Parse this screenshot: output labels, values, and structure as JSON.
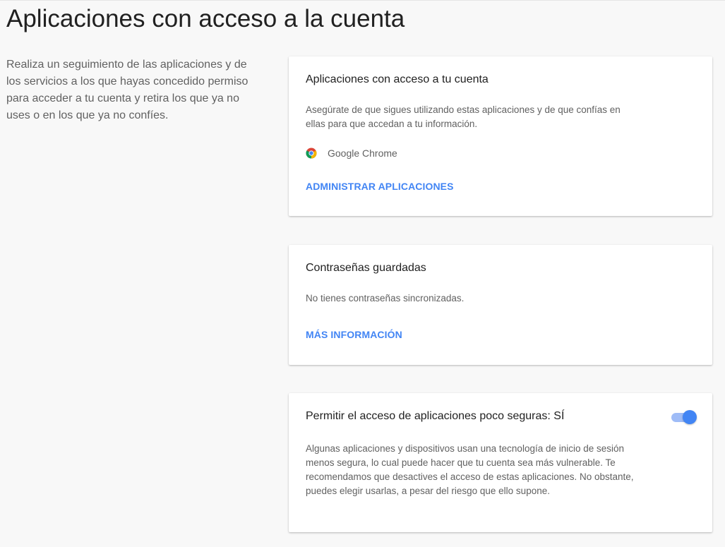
{
  "page": {
    "title": "Aplicaciones con acceso a la cuenta",
    "intro": "Realiza un seguimiento de las aplicaciones y de los servicios a los que hayas concedido permiso para acceder a tu cuenta y retira los que ya no uses o en los que ya no confíes."
  },
  "apps_card": {
    "title": "Aplicaciones con acceso a tu cuenta",
    "description": "Asegúrate de que sigues utilizando estas aplicaciones y de que confías en ellas para que accedan a tu información.",
    "apps": [
      {
        "name": "Google Chrome",
        "icon": "chrome-icon"
      }
    ],
    "action_label": "ADMINISTRAR APLICACIONES"
  },
  "passwords_card": {
    "title": "Contraseñas guardadas",
    "description": "No tienes contraseñas sincronizadas.",
    "action_label": "MÁS INFORMACIÓN"
  },
  "less_secure_card": {
    "title": "Permitir el acceso de aplicaciones poco seguras: SÍ",
    "toggle_on": true,
    "description": "Algunas aplicaciones y dispositivos usan una tecnología de inicio de sesión menos segura, lo cual puede hacer que tu cuenta sea más vulnerable. Te recomendamos que desactives el acceso de estas aplicaciones. No obstante, puedes elegir usarlas, a pesar del riesgo que ello supone."
  },
  "colors": {
    "accent": "#4285f4",
    "toggle_track": "#9fbcf7",
    "background": "#f8f8f8"
  }
}
